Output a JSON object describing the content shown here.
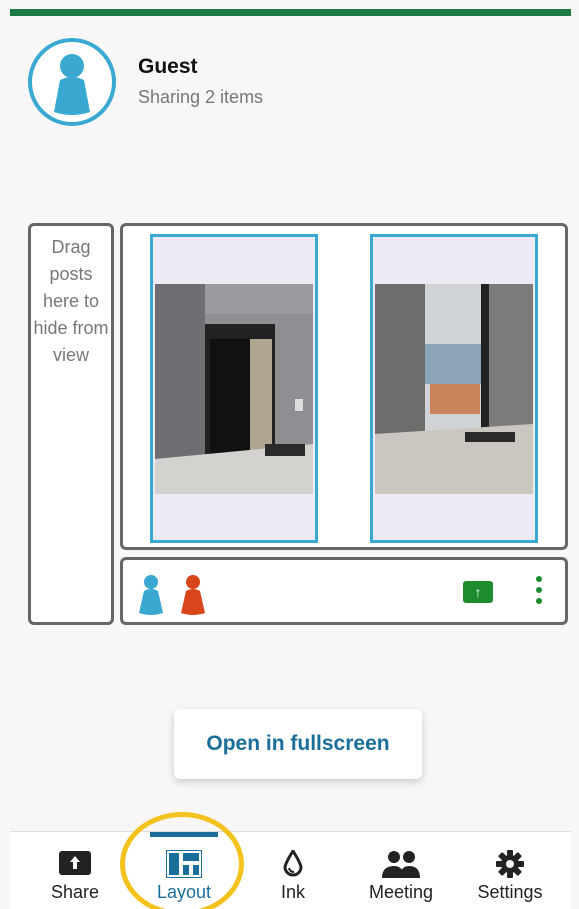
{
  "header": {
    "name": "Guest",
    "subtitle": "Sharing 2 items",
    "avatar_icon": "person-pawn-icon",
    "avatar_color": "#39a9d2"
  },
  "hide_zone": {
    "text": "Drag posts here to hide from view"
  },
  "posts": [
    {
      "icon": "photo-office-door-icon"
    },
    {
      "icon": "photo-office-window-icon"
    }
  ],
  "participants": [
    {
      "icon": "person-pawn-icon",
      "color": "#39a9d2"
    },
    {
      "icon": "person-pawn-icon",
      "color": "#d9461c"
    }
  ],
  "actions": {
    "upload_label": "↑",
    "upload_icon": "upload-arrow-icon",
    "more_icon": "more-vertical-icon"
  },
  "fullscreen": {
    "label": "Open in fullscreen"
  },
  "nav": {
    "items": [
      {
        "label": "Share",
        "icon": "share-upload-icon"
      },
      {
        "label": "Layout",
        "icon": "layout-grid-icon",
        "active": true
      },
      {
        "label": "Ink",
        "icon": "ink-drop-icon"
      },
      {
        "label": "Meeting",
        "icon": "people-icon"
      },
      {
        "label": "Settings",
        "icon": "gear-icon"
      }
    ]
  },
  "colors": {
    "accent": "#1a6f9a",
    "brand_green": "#1c7a42",
    "post_border": "#39a9d2",
    "highlight": "#f4c21c"
  }
}
